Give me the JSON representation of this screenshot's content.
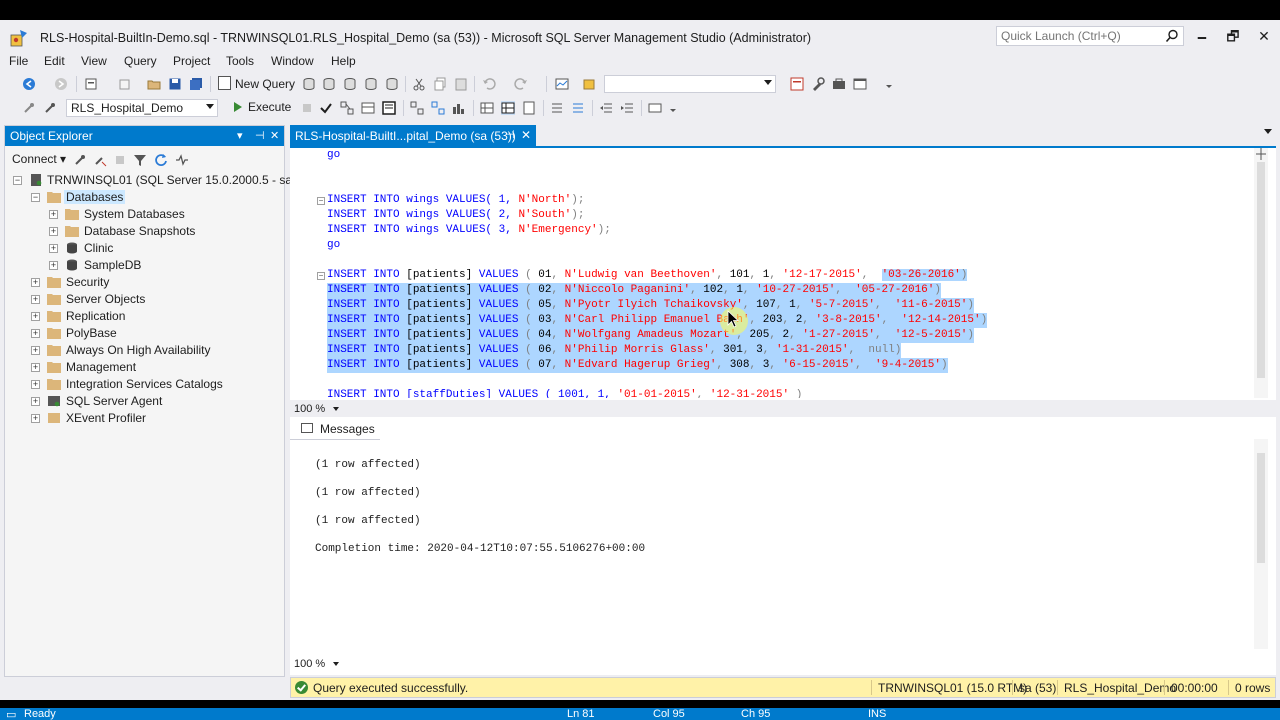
{
  "window": {
    "title": "RLS-Hospital-BuiltIn-Demo.sql - TRNWINSQL01.RLS_Hospital_Demo (sa (53)) - Microsoft SQL Server Management Studio (Administrator)",
    "quick_launch_placeholder": "Quick Launch (Ctrl+Q)",
    "minimize": "🗕",
    "maximize": "🗗",
    "close": "✕"
  },
  "menu": [
    "File",
    "Edit",
    "View",
    "Query",
    "Project",
    "Tools",
    "Window",
    "Help"
  ],
  "toolbar": {
    "new_query": "New Query",
    "database": "RLS_Hospital_Demo",
    "execute": "Execute"
  },
  "object_explorer": {
    "title": "Object Explorer",
    "pin": "⊣",
    "close": "✕",
    "dropdown": "▾",
    "connect": "Connect",
    "server": "TRNWINSQL01 (SQL Server 15.0.2000.5 - sa)",
    "databases": "Databases",
    "db_children": [
      "System Databases",
      "Database Snapshots",
      "Clinic",
      "SampleDB"
    ],
    "server_children": [
      "Security",
      "Server Objects",
      "Replication",
      "PolyBase",
      "Always On High Availability",
      "Management",
      "Integration Services Catalogs",
      "SQL Server Agent",
      "XEvent Profiler"
    ]
  },
  "document_tab": {
    "label": "RLS-Hospital-BuiltI...pital_Demo (sa (53))",
    "pin": "⊣",
    "close": "✕"
  },
  "editor": {
    "go1": "go",
    "wings": [
      {
        "prefix": "INSERT INTO wings VALUES( 1, ",
        "str": "N'North'",
        "suffix": ");"
      },
      {
        "prefix": "INSERT INTO wings VALUES( 2, ",
        "str": "N'South'",
        "suffix": ");"
      },
      {
        "prefix": "INSERT INTO wings VALUES( 3, ",
        "str": "N'Emergency'",
        "suffix": ");"
      }
    ],
    "go2": "go",
    "patients": [
      {
        "id": "01",
        "name": "N'Ludwig van Beethoven'",
        "room": "101",
        "wing": "1",
        "start": "'12-17-2015'",
        "end": "'03-26-2016'"
      },
      {
        "id": "02",
        "name": "N'Niccolo Paganini'",
        "room": "102",
        "wing": "1",
        "start": "'10-27-2015'",
        "end": "'05-27-2016'"
      },
      {
        "id": "05",
        "name": "N'Pyotr Ilyich Tchaikovsky'",
        "room": "107",
        "wing": "1",
        "start": "'5-7-2015'",
        "end": "'11-6-2015'"
      },
      {
        "id": "03",
        "name": "N'Carl Philipp Emanuel Bach'",
        "room": "203",
        "wing": "2",
        "start": "'3-8-2015'",
        "end": "'12-14-2015'"
      },
      {
        "id": "04",
        "name": "N'Wolfgang Amadeus Mozart'",
        "room": "205",
        "wing": "2",
        "start": "'1-27-2015'",
        "end": "'12-5-2015'"
      },
      {
        "id": "06",
        "name": "N'Philip Morris Glass'",
        "room": "301",
        "wing": "3",
        "start": "'1-31-2015'",
        "end": "null"
      },
      {
        "id": "07",
        "name": "N'Edvard Hagerup Grieg'",
        "room": "308",
        "wing": "3",
        "start": "'6-15-2015'",
        "end": "'9-4-2015'"
      }
    ],
    "staff_line": {
      "prefix": "INSERT INTO [staffDuties] VALUES ( 1001, 1, ",
      "s1": "'01-01-2015'",
      "s2": "'12-31-2015'",
      "suffix": " )"
    },
    "zoom": "100 %"
  },
  "messages": {
    "tab": "Messages",
    "lines": [
      "(1 row affected)",
      "(1 row affected)",
      "(1 row affected)"
    ],
    "completion": "Completion time: 2020-04-12T10:07:55.5106276+00:00",
    "zoom": "100 %"
  },
  "query_status": {
    "text": "Query executed successfully.",
    "server": "TRNWINSQL01 (15.0 RTM)",
    "user": "sa (53)",
    "db": "RLS_Hospital_Demo",
    "time": "00:00:00",
    "rows": "0 rows"
  },
  "vs_status": {
    "ready": "Ready",
    "ln": "Ln 81",
    "col": "Col 95",
    "ch": "Ch 95",
    "ins": "INS"
  },
  "colors": {
    "accent": "#007acc",
    "selection": "#add6ff",
    "keyword": "#0000ff",
    "string": "#ff0000",
    "success_bar": "#fff2a8"
  }
}
